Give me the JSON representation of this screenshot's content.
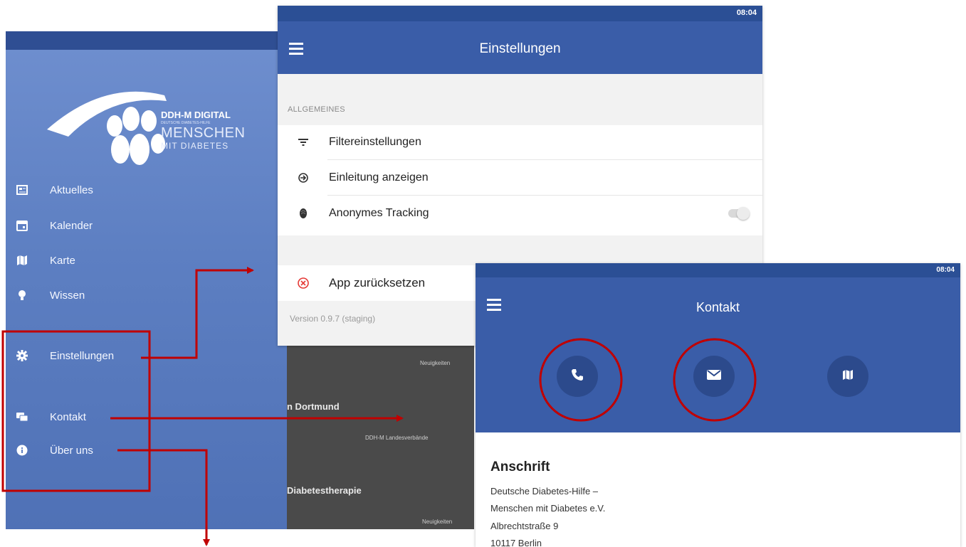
{
  "drawer": {
    "logo": {
      "brand": "DDH-M DIGITAL",
      "line_small": "DEUTSCHE DIABETES-HILFE",
      "line_large": "MENSCHEN",
      "line_sub": "MIT DIABETES"
    },
    "items": [
      {
        "label": "Aktuelles",
        "icon": "newspaper-icon"
      },
      {
        "label": "Kalender",
        "icon": "calendar-icon"
      },
      {
        "label": "Karte",
        "icon": "map-icon"
      },
      {
        "label": "Wissen",
        "icon": "lightbulb-icon"
      },
      {
        "label": "Einstellungen",
        "icon": "gear-icon"
      },
      {
        "label": "Kontakt",
        "icon": "chat-icon"
      },
      {
        "label": "Über uns",
        "icon": "info-icon"
      }
    ]
  },
  "behind": {
    "t1": "n Dortmund",
    "s1": "DDH-M Landesverbände",
    "t2": "Diabetestherapie",
    "s0": "Neuigkeiten",
    "s2": "Neuigkeiten"
  },
  "settings": {
    "time": "08:04",
    "title": "Einstellungen",
    "section": "ALLGEMEINES",
    "rows": [
      {
        "label": "Filtereinstellungen",
        "icon": "filter-icon"
      },
      {
        "label": "Einleitung anzeigen",
        "icon": "login-icon"
      },
      {
        "label": "Anonymes Tracking",
        "icon": "fingerprint-icon",
        "toggle": false
      }
    ],
    "reset": "App zurücksetzen",
    "version": "Version 0.9.7 (staging)"
  },
  "kontakt": {
    "time": "08:04",
    "title": "Kontakt",
    "actions": [
      "phone-icon",
      "mail-icon",
      "map-icon"
    ],
    "heading": "Anschrift",
    "address": [
      "Deutsche Diabetes-Hilfe –",
      "Menschen mit Diabetes e.V.",
      "Albrechtstraße 9",
      "10117 Berlin"
    ]
  },
  "colors": {
    "annotation": "#c00000",
    "appbar": "#3a5da8",
    "status": "#2b4f95"
  }
}
